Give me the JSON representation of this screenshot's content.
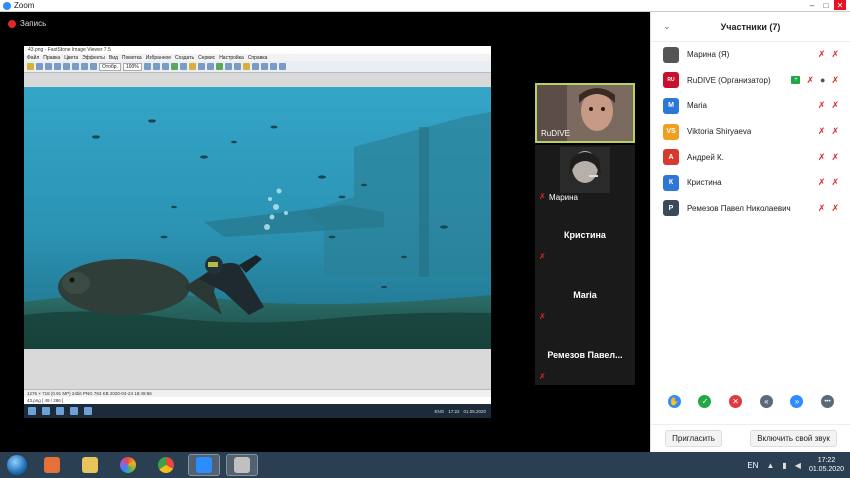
{
  "window": {
    "title": "Zoom",
    "min": "–",
    "max": "□",
    "close": "✕"
  },
  "recording": {
    "label": "Запись"
  },
  "viewer": {
    "title": "43.png - FastStone Image Viewer 7.5",
    "menu": [
      "Файл",
      "Правка",
      "Цвета",
      "Эффекты",
      "Вид",
      "Пометка",
      "Избранное",
      "Создать",
      "Сервис",
      "Настройка",
      "Справка"
    ],
    "zoom": "100%",
    "fit_label": "Отобр.",
    "status": "1276 × 718 (0.91 MP)  24bit  PNG  763 KB  2020-04-24 18:49:56",
    "filename": "43.png [ 49 / 286 ]",
    "inner_lang": "ENG",
    "inner_time": "17:22",
    "inner_date": "01.05.2020"
  },
  "tiles": [
    {
      "name": "RuDIVE",
      "mic_icon": ""
    },
    {
      "name": "Марина",
      "mic_icon": "✗"
    },
    {
      "name": "Кристина",
      "mic_icon": "✗"
    },
    {
      "name": "Maria",
      "mic_icon": "✗"
    },
    {
      "name": "Ремезов  Павел...",
      "mic_icon": "✗"
    }
  ],
  "participants": {
    "title": "Участники (7)",
    "chevron": "⌄",
    "list": [
      {
        "name": "Марина (Я)",
        "initials": "",
        "color": "#555555"
      },
      {
        "name": "RuDIVE (Организатор)",
        "initials": "RU",
        "color": "#c8102e"
      },
      {
        "name": "Maria",
        "initials": "M",
        "color": "#2d77d6"
      },
      {
        "name": "Viktoria Shiryaeva",
        "initials": "VS",
        "color": "#f0a020"
      },
      {
        "name": "Андрей К.",
        "initials": "А",
        "color": "#d63a2d"
      },
      {
        "name": "Кристина",
        "initials": "К",
        "color": "#2d77d6"
      },
      {
        "name": "Ремезов Павел Николаевич",
        "initials": "Р",
        "color": "#3a4a5a"
      }
    ],
    "mic_muted": "✗",
    "cam_muted": "✗",
    "mic_on": "●",
    "badge": "+",
    "invite": "Пригласить",
    "unmute": "Включить свой звук"
  },
  "reactions": [
    {
      "icon": "✋",
      "color": "#2d8cff"
    },
    {
      "icon": "✓",
      "color": "#23a645"
    },
    {
      "icon": "✕",
      "color": "#e0383e"
    },
    {
      "icon": "«",
      "color": "#5a6a7a"
    },
    {
      "icon": "»",
      "color": "#2d8cff"
    },
    {
      "icon": "•••",
      "color": "#5a6a7a"
    }
  ],
  "taskbar": {
    "lang": "EN",
    "time": "17:22",
    "date": "01.05.2020",
    "apps": [
      {
        "color": "#e5703a"
      },
      {
        "color": "#e8c45a"
      },
      {
        "color": "#6ab04c"
      },
      {
        "color": "#e84a3a"
      },
      {
        "color": "#2d8cff"
      },
      {
        "color": "#c0c0c0"
      }
    ]
  }
}
